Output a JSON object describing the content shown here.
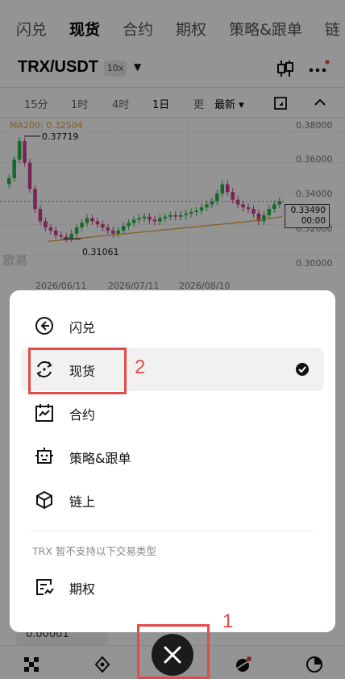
{
  "top_tabs": [
    "闪兑",
    "现货",
    "合约",
    "期权",
    "策略&跟单",
    "链"
  ],
  "pair": {
    "symbol": "TRX/USDT",
    "leverage": "10x"
  },
  "timeframes": [
    "15分",
    "1时",
    "4时",
    "1日",
    "更",
    "最新 ▾"
  ],
  "chart": {
    "ma_label": "MA200: 0.32504",
    "y_ticks": [
      "0.38000",
      "0.36000",
      "0.34000",
      "0.32000",
      "0.30000"
    ],
    "x_ticks": [
      "2026/06/11",
      "2026/07/11",
      "2026/08/10"
    ],
    "high_label": "0.37719",
    "low_label": "0.31061",
    "last_price": "0.33490",
    "countdown": "00:00",
    "watermark": "欧易"
  },
  "chart_data": {
    "type": "candlestick",
    "title": "",
    "ylim": [
      0.295,
      0.385
    ],
    "y_ticks": [
      0.38,
      0.36,
      0.34,
      0.32,
      0.3
    ],
    "x_ticks": [
      "2026/06/11",
      "2026/07/11",
      "2026/08/10"
    ],
    "ma200_last": 0.32504,
    "annotated_high": 0.37719,
    "annotated_low": 0.31061,
    "last_price": 0.3349,
    "close_series": [
      0.35,
      0.362,
      0.374,
      0.36,
      0.343,
      0.33,
      0.322,
      0.318,
      0.316,
      0.313,
      0.312,
      0.311,
      0.314,
      0.318,
      0.321,
      0.324,
      0.322,
      0.32,
      0.318,
      0.316,
      0.314,
      0.316,
      0.319,
      0.321,
      0.323,
      0.324,
      0.325,
      0.323,
      0.322,
      0.324,
      0.325,
      0.326,
      0.325,
      0.326,
      0.327,
      0.328,
      0.329,
      0.331,
      0.333,
      0.335,
      0.34,
      0.346,
      0.341,
      0.336,
      0.333,
      0.331,
      0.33,
      0.327,
      0.322,
      0.326,
      0.33,
      0.333,
      0.335
    ],
    "ma200_series": [
      0.309,
      0.31,
      0.311,
      0.312,
      0.313,
      0.314,
      0.315,
      0.316,
      0.317,
      0.318,
      0.319,
      0.32,
      0.321,
      0.322,
      0.3235,
      0.325
    ]
  },
  "menu": {
    "items": [
      {
        "label": "闪兑",
        "icon": "swap-icon",
        "selected": false
      },
      {
        "label": "现货",
        "icon": "spot-icon",
        "selected": true
      },
      {
        "label": "合约",
        "icon": "futures-icon",
        "selected": false
      },
      {
        "label": "策略&跟单",
        "icon": "bot-icon",
        "selected": false
      },
      {
        "label": "链上",
        "icon": "onchain-icon",
        "selected": false
      }
    ],
    "note": "TRX 暂不支持以下交易类型",
    "unsupported": [
      {
        "label": "期权",
        "icon": "options-icon"
      }
    ]
  },
  "qty_peek": "0.00001",
  "annotations": [
    "1",
    "2"
  ],
  "colors": {
    "up": "#2bb34a",
    "down": "#cf3e8a",
    "ma": "#e3a13b",
    "annotation": "#e34b4b"
  }
}
